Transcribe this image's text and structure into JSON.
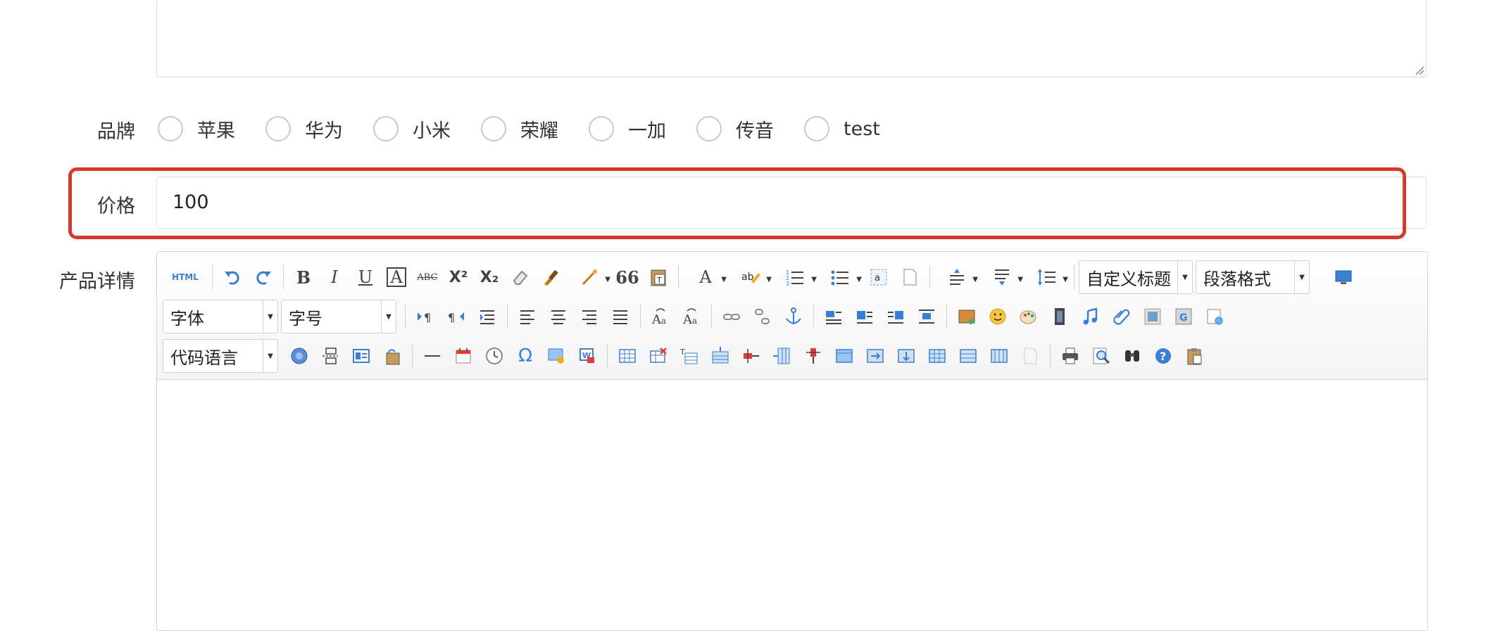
{
  "form": {
    "brand_label": "品牌",
    "brand_options": [
      "苹果",
      "华为",
      "小米",
      "荣耀",
      "一加",
      "传音",
      "test"
    ],
    "price_label": "价格",
    "price_value": "100",
    "detail_label": "产品详情"
  },
  "editor": {
    "row1": {
      "custom_title": "自定义标题",
      "paragraph_format": "段落格式"
    },
    "row2": {
      "font_family": "字体",
      "font_size": "字号"
    },
    "row3": {
      "code_language": "代码语言"
    },
    "button_glyphs": {
      "html": "HTML",
      "bold": "B",
      "italic": "I",
      "underline": "U",
      "fontborder": "A",
      "strike": "ABC",
      "superscript": "X²",
      "subscript": "X₂",
      "quote": "66",
      "forecolor": "A",
      "omega": "Ω"
    },
    "colors": {
      "accent_blue": "#3b7fd4",
      "highlight_red": "#d63a2c"
    }
  }
}
